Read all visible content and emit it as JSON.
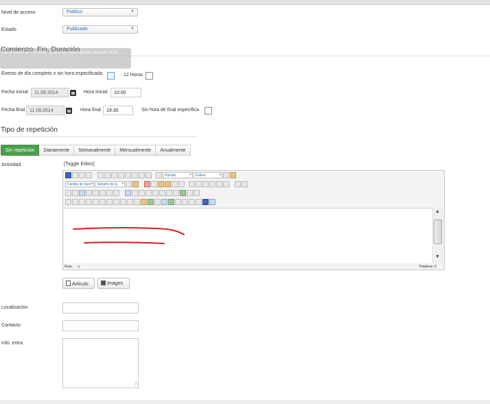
{
  "form": {
    "nivel_label": "Nivel de acceso",
    "nivel_value": "Publico",
    "estado_label": "Estado",
    "estado_value": "Publicado"
  },
  "schedule": {
    "section_title": "Comienzo, Fin, Duración",
    "tooltip_text": "Esto un evento de todo el día - es decir, sin fecha específica de inicio o final",
    "allday_label": "Evento de día completo o sin hora especificada",
    "h12_label": "12 Horas",
    "start_date_label": "Fecha inicial",
    "start_date_value": "11.09.2014",
    "start_time_label": "Hora inicial",
    "start_time_value": "10:00",
    "end_date_label": "Fecha final",
    "end_date_value": "11.09.2014",
    "end_time_label": "Hora final",
    "end_time_value": "19:30",
    "no_end_label": "Sin hora de final específica"
  },
  "repeat": {
    "section_title": "Tipo de repetición",
    "tabs": [
      "Sin repetición",
      "Diariamente",
      "Semanalmente",
      "Mensualmente",
      "Anualmente"
    ]
  },
  "activity": {
    "label": "Actividad",
    "toggle": "[Toggle Editor]",
    "format_select": "Párrafo",
    "styles_select": "Estilos",
    "font_family_select": "Familia de fuen",
    "font_size_select": "Tamaño de la",
    "path_label": "Ruta:",
    "path_value": "p",
    "words_label": "Palabras:",
    "words_value": "0",
    "article_button": "Artículo",
    "image_button": "Imagen",
    "annotation_color": "#d22020"
  },
  "extra": {
    "location_label": "Localización",
    "contact_label": "Contacto",
    "info_label": "Info. extra"
  }
}
